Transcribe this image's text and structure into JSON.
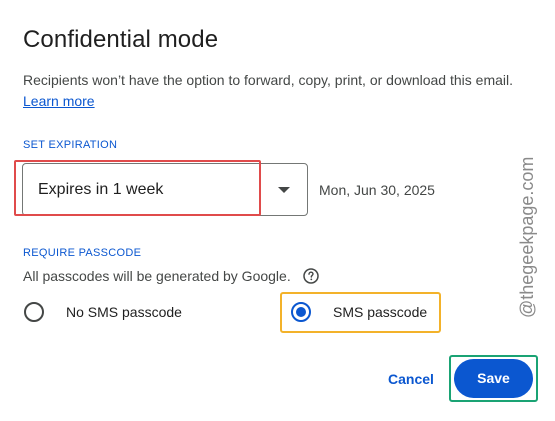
{
  "dialog": {
    "title": "Confidential mode",
    "description": "Recipients won’t have the option to forward, copy, print, or download this email.",
    "learn_more": "Learn more"
  },
  "expiration": {
    "section_label": "SET EXPIRATION",
    "selected_value": "Expires in 1 week",
    "date": "Mon, Jun 30, 2025"
  },
  "passcode": {
    "section_label": "REQUIRE PASSCODE",
    "info": "All passcodes will be generated by Google.",
    "options": [
      {
        "label": "No SMS passcode",
        "selected": false
      },
      {
        "label": "SMS passcode",
        "selected": true
      }
    ]
  },
  "actions": {
    "cancel_label": "Cancel",
    "save_label": "Save"
  },
  "watermark": {
    "text": "@thegeekpage.com"
  },
  "colors": {
    "accent": "#0b57d0",
    "highlight_red": "#e04b4b",
    "highlight_yellow": "#f3b22a",
    "highlight_green": "#1aa374"
  }
}
